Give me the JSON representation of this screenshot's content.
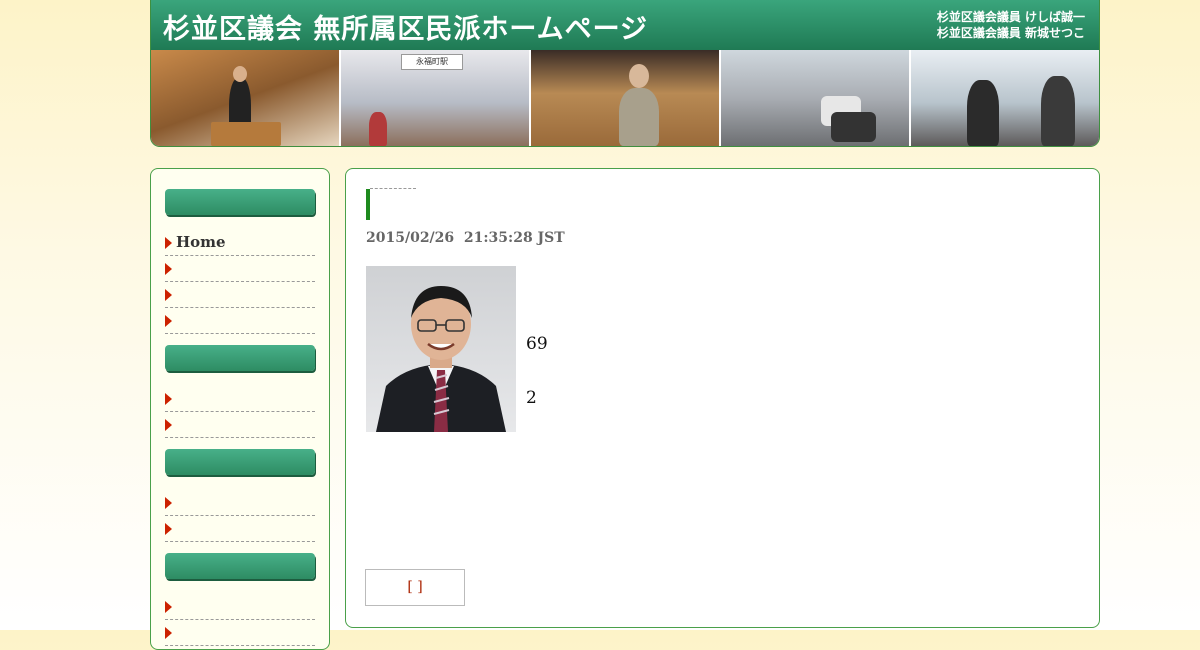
{
  "header": {
    "site_title": "杉並区議会 無所属区民派ホームページ",
    "member_1": "杉並区議会議員 けしば誠一",
    "member_2": "杉並区議会議員 新城せつこ",
    "photo_sign": "永福町駅"
  },
  "sidebar": {
    "items": [
      {
        "label": "Home"
      },
      {
        "label": ""
      },
      {
        "label": ""
      },
      {
        "label": ""
      },
      {
        "label": ""
      },
      {
        "label": ""
      },
      {
        "label": ""
      },
      {
        "label": ""
      },
      {
        "label": ""
      },
      {
        "label": ""
      }
    ]
  },
  "post": {
    "date": "2015/02/26  21:35:28 JST",
    "line_1": "69",
    "line_2": "2",
    "button_label": "[ ]"
  },
  "colors": {
    "header_green": "#2b8a62",
    "border_green": "#4aa04a",
    "arrow_red": "#cc2200"
  }
}
